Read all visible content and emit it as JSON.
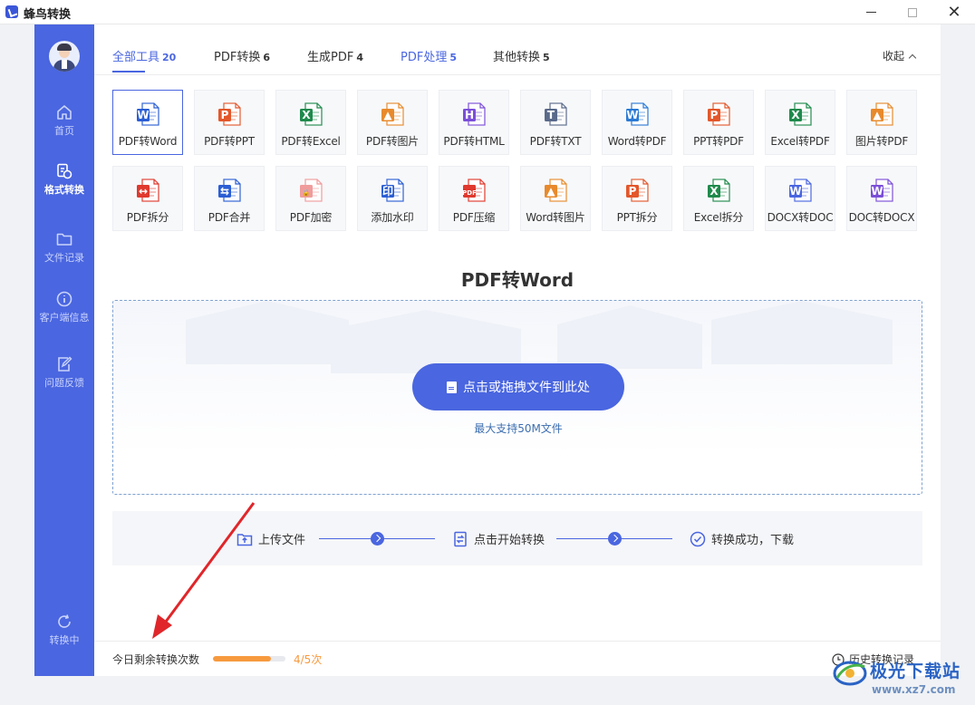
{
  "window": {
    "title": "蜂鸟转换",
    "minimize_icon": "minimize-icon",
    "maximize_icon": "maximize-icon",
    "close_icon": "close-icon",
    "close_glyph": "✕"
  },
  "sidebar": {
    "background": "#4a66e0",
    "items": [
      {
        "label": "首页",
        "icon": "home-icon",
        "active": false
      },
      {
        "label": "格式转换",
        "icon": "convert-icon",
        "active": true
      },
      {
        "label": "文件记录",
        "icon": "folder-icon",
        "active": false
      },
      {
        "label": "客户端信息",
        "icon": "info-icon",
        "active": false
      },
      {
        "label": "问题反馈",
        "icon": "feedback-icon",
        "active": false
      },
      {
        "label": "转换中",
        "icon": "refresh-icon",
        "active": false
      }
    ]
  },
  "tabs": [
    {
      "label": "全部工具",
      "count": "20",
      "active": true
    },
    {
      "label": "PDF转换",
      "count": "6",
      "active": false
    },
    {
      "label": "生成PDF",
      "count": "4",
      "active": false
    },
    {
      "label": "PDF处理",
      "count": "5",
      "active": false
    },
    {
      "label": "其他转换",
      "count": "5",
      "active": false
    }
  ],
  "collapse_label": "收起",
  "tools": [
    {
      "label": "PDF转Word",
      "icon": "pdf-to-word-icon",
      "active": true
    },
    {
      "label": "PDF转PPT",
      "icon": "pdf-to-ppt-icon"
    },
    {
      "label": "PDF转Excel",
      "icon": "pdf-to-excel-icon"
    },
    {
      "label": "PDF转图片",
      "icon": "pdf-to-image-icon"
    },
    {
      "label": "PDF转HTML",
      "icon": "pdf-to-html-icon"
    },
    {
      "label": "PDF转TXT",
      "icon": "pdf-to-txt-icon"
    },
    {
      "label": "Word转PDF",
      "icon": "word-to-pdf-icon"
    },
    {
      "label": "PPT转PDF",
      "icon": "ppt-to-pdf-icon"
    },
    {
      "label": "Excel转PDF",
      "icon": "excel-to-pdf-icon"
    },
    {
      "label": "图片转PDF",
      "icon": "image-to-pdf-icon"
    },
    {
      "label": "PDF拆分",
      "icon": "pdf-split-icon"
    },
    {
      "label": "PDF合并",
      "icon": "pdf-merge-icon"
    },
    {
      "label": "PDF加密",
      "icon": "pdf-encrypt-icon"
    },
    {
      "label": "添加水印",
      "icon": "watermark-icon"
    },
    {
      "label": "PDF压缩",
      "icon": "pdf-compress-icon"
    },
    {
      "label": "Word转图片",
      "icon": "word-to-image-icon"
    },
    {
      "label": "PPT拆分",
      "icon": "ppt-split-icon"
    },
    {
      "label": "Excel拆分",
      "icon": "excel-split-icon"
    },
    {
      "label": "DOCX转DOC",
      "icon": "docx-to-doc-icon"
    },
    {
      "label": "DOC转DOCX",
      "icon": "doc-to-docx-icon"
    }
  ],
  "converter": {
    "title": "PDF转Word",
    "upload_button": "点击或拖拽文件到此处",
    "hint": "最大支持50M文件"
  },
  "steps": [
    {
      "label": "上传文件",
      "icon": "upload-folder-icon"
    },
    {
      "label": "点击开始转换",
      "icon": "convert-doc-icon"
    },
    {
      "label": "转换成功，下载",
      "icon": "check-circle-icon"
    }
  ],
  "footer": {
    "remaining_label": "今日剩余转换次数",
    "remaining_count": "4/5次",
    "remaining_fraction": 0.8,
    "history_label": "历史转换记录"
  },
  "watermark": {
    "text": "极光下载站",
    "url": "www.xz7.com"
  },
  "colors": {
    "accent": "#4a66e0",
    "orange": "#f79a3e",
    "annotation": "#e0262a"
  }
}
